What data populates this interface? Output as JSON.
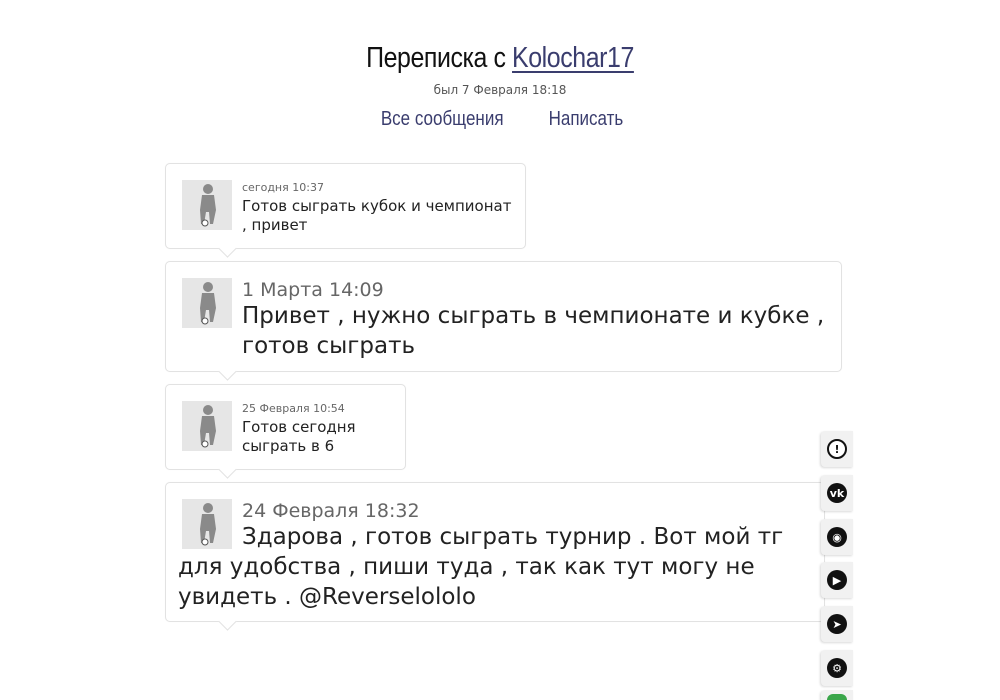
{
  "header": {
    "title_prefix": "Переписка с ",
    "username": "Kolochar17",
    "last_seen": "был 7 Февраля 18:18"
  },
  "nav": {
    "all_messages": "Все сообщения",
    "write": "Написать"
  },
  "messages": [
    {
      "date": "сегодня 10:37",
      "text": "Готов сыграть кубок и чемпионат , привет"
    },
    {
      "date": "1 Марта 14:09",
      "text": "Привет , нужно сыграть в чемпионате и кубке , готов сыграть"
    },
    {
      "date": "25 Февраля 10:54",
      "text": "Готов сегодня сыграть в 6"
    },
    {
      "date": "24 Февраля 18:32",
      "text": "Здарова , готов сыграть турнир . Вот мой тг для удобства , пиши туда , так как тут могу не увидеть . @Reverselololo"
    }
  ],
  "social_icons": [
    {
      "name": "report-icon",
      "glyph": "!"
    },
    {
      "name": "vk-icon",
      "glyph": "vk"
    },
    {
      "name": "discord-icon",
      "glyph": "◉"
    },
    {
      "name": "youtube-icon",
      "glyph": "▶"
    },
    {
      "name": "telegram-icon",
      "glyph": "➤"
    },
    {
      "name": "steam-icon",
      "glyph": "⚙"
    },
    {
      "name": "whatsapp-icon",
      "glyph": ""
    }
  ],
  "colors": {
    "link": "#3a3d6e",
    "border": "#e2e2e2",
    "avatar_bg": "#e4e4e4"
  }
}
